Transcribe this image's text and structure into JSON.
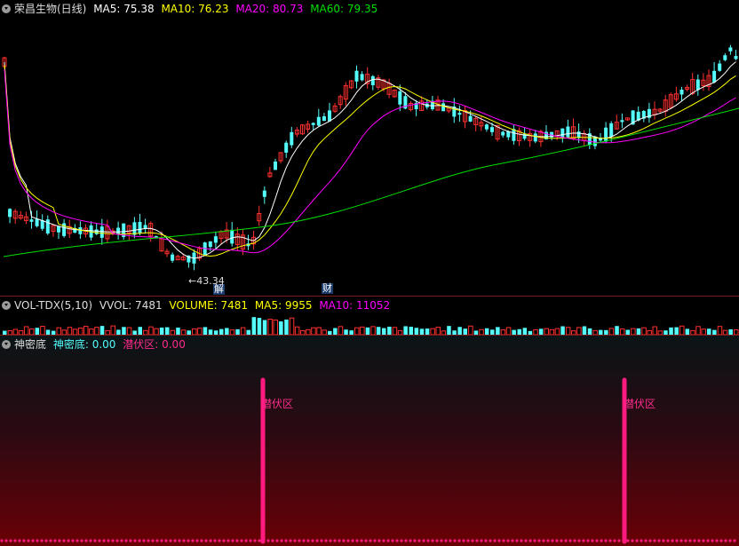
{
  "main": {
    "stock_name": "荣昌生物(日线)",
    "ma5_label": "MA5: 75.38",
    "ma10_label": "MA10: 76.23",
    "ma20_label": "MA20: 80.73",
    "ma60_label": "MA60: 79.35",
    "low_marker": "43.34",
    "event_tag_1": "解",
    "event_tag_2": "财"
  },
  "volume": {
    "indicator": "VOL-TDX(5,10)",
    "vvol_label": "VVOL: 7481",
    "volume_label": "VOLUME: 7481",
    "ma5_label": "MA5: 9955",
    "ma10_label": "MA10: 11052"
  },
  "indicator": {
    "name": "神密底",
    "value1_label": "神密底: 0.00",
    "value2_label": "潜伏区: 0.00",
    "signal_text": "潜伏区"
  },
  "colors": {
    "up": "#ff3030",
    "down": "#54fcfc",
    "ma5": "#ffffff",
    "ma10": "#ffff00",
    "ma20": "#ff00ff",
    "ma60": "#00e000",
    "signal": "#ff1a80"
  }
}
